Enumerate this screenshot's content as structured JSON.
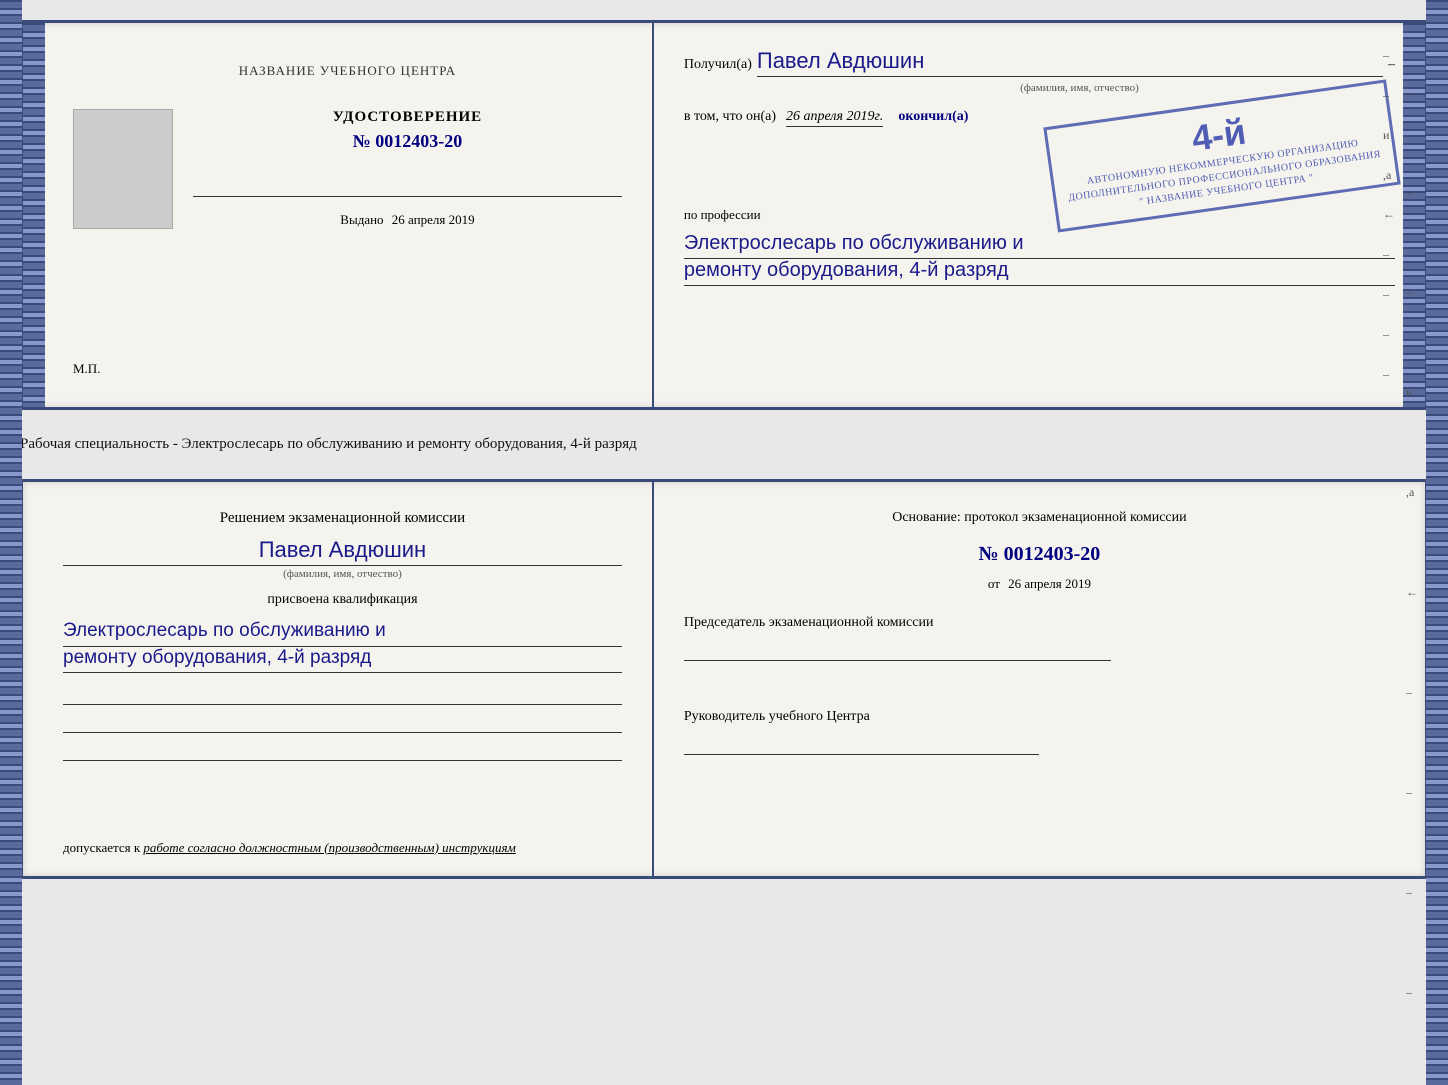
{
  "top_doc": {
    "left": {
      "training_center_label": "НАЗВАНИЕ УЧЕБНОГО ЦЕНТРА",
      "photo_alt": "фото",
      "udostoverenie_title": "УДОСТОВЕРЕНИЕ",
      "number": "№ 0012403-20",
      "issued_label": "Выдано",
      "issued_date": "26 апреля 2019",
      "mp_label": "М.П."
    },
    "right": {
      "received_prefix": "Получил(а)",
      "received_name": "Павел Авдюшин",
      "fio_label": "(фамилия, имя, отчество)",
      "vtom_prefix": "в том, что он(а)",
      "vtom_date": "26 апреля 2019г.",
      "okonchil": "окончил(а)",
      "stamp_number": "4-й",
      "stamp_line1": "АВТОНОМНУЮ НЕКОММЕРЧЕСКУЮ ОРГАНИЗАЦИЮ",
      "stamp_line2": "ДОПОЛНИТЕЛЬНОГО ПРОФЕССИОНАЛЬНОГО ОБРАЗОВАНИЯ",
      "stamp_line3": "\" НАЗВАНИЕ УЧЕБНОГО ЦЕНТРА \"",
      "po_professii": "по профессии",
      "profession_line1": "Электрослесарь по обслуживанию и",
      "profession_line2": "ремонту оборудования, 4-й разряд"
    }
  },
  "middle_text": "Рабочая специальность - Электрослесарь по обслуживанию и ремонту оборудования, 4-й разряд",
  "bottom_doc": {
    "left": {
      "commission_title": "Решением экзаменационной комиссии",
      "person_name": "Павел Авдюшин",
      "fio_label": "(фамилия, имя, отчество)",
      "prisvoena_label": "присвоена квалификация",
      "qualification_line1": "Электрослесарь по обслуживанию и",
      "qualification_line2": "ремонту оборудования, 4-й разряд",
      "dopuskaetsya_prefix": "допускается к",
      "dopuskaetsya_italic": "работе согласно должностным (производственным) инструкциям"
    },
    "right": {
      "osnovanie_title": "Основание: протокол экзаменационной комиссии",
      "protocol_number": "№ 0012403-20",
      "ot_prefix": "от",
      "ot_date": "26 апреля 2019",
      "chairman_title": "Председатель экзаменационной комиссии",
      "rukovoditel_title": "Руководитель учебного Центра"
    }
  }
}
